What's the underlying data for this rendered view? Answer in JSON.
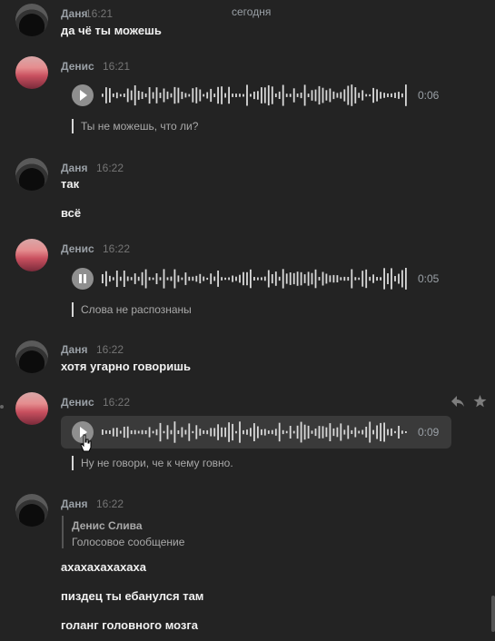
{
  "date_separator": "сегодня",
  "messages": [
    {
      "author": "Даня",
      "time": "16:21",
      "texts": [
        "да чё ты можешь"
      ]
    },
    {
      "author": "Денис",
      "time": "16:21",
      "voice": {
        "duration": "0:06",
        "state": "play",
        "transcript": "Ты не можешь, что ли?"
      }
    },
    {
      "author": "Даня",
      "time": "16:22",
      "texts": [
        "так",
        "всё"
      ]
    },
    {
      "author": "Денис",
      "time": "16:22",
      "voice": {
        "duration": "0:05",
        "state": "pause",
        "transcript": "Слова не распознаны"
      }
    },
    {
      "author": "Даня",
      "time": "16:22",
      "texts": [
        "хотя угарно говоришь"
      ]
    },
    {
      "author": "Денис",
      "time": "16:22",
      "voice": {
        "duration": "0:09",
        "state": "play",
        "transcript": "Ну не говори, че к чему говно."
      }
    },
    {
      "author": "Даня",
      "time": "16:22",
      "quote": {
        "name": "Денис Слива",
        "text": "Голосовое сообщение"
      },
      "texts": [
        "ахахахахахаха",
        "пиздец ты ебанулся там",
        "голанг головного мозга"
      ]
    }
  ],
  "icons": {
    "reply": "reply-arrow-icon",
    "star": "star-icon"
  },
  "colors": {
    "background": "#232323",
    "waveform": "#d8d8d8",
    "voice_hover": "#3a3a3a"
  }
}
